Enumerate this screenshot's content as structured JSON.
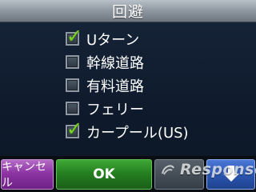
{
  "title": "回避",
  "options": [
    {
      "label": "Uターン",
      "checked": true
    },
    {
      "label": "幹線道路",
      "checked": false
    },
    {
      "label": "有料道路",
      "checked": false
    },
    {
      "label": "フェリー",
      "checked": false
    },
    {
      "label": "カープール(US)",
      "checked": true
    }
  ],
  "buttons": {
    "cancel": "キャンセル",
    "ok": "OK",
    "down_icon": "down-arrow-icon"
  },
  "watermark": {
    "text": "Response."
  },
  "colors": {
    "title_bar": "#8e979f",
    "background": "#17253a",
    "check": "#79d321",
    "cancel_button": "#8d35a4",
    "ok_button": "#247e1f",
    "blank_button": "#353d46",
    "down_button": "#2b56b2"
  }
}
